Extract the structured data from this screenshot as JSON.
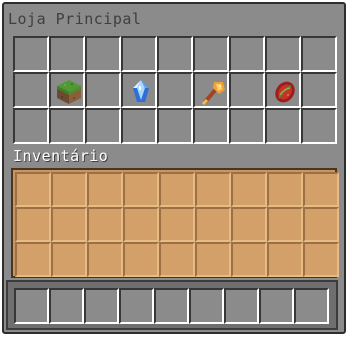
{
  "shop": {
    "title": "Loja Principal",
    "rows": 3,
    "columns": 9,
    "items": [
      {
        "row": 1,
        "col": 1,
        "icon": "grass-block-icon"
      },
      {
        "row": 1,
        "col": 3,
        "icon": "diamond-gem-icon"
      },
      {
        "row": 1,
        "col": 5,
        "icon": "golden-axe-icon"
      },
      {
        "row": 1,
        "col": 7,
        "icon": "red-seed-icon"
      }
    ]
  },
  "inventory": {
    "title": "Inventário",
    "rows": 3,
    "columns": 9
  },
  "hotbar": {
    "slots": 9
  },
  "colors": {
    "panel": "#8b8b8b",
    "inventory_bg": "#c99661",
    "title_text": "#3f3f3f"
  }
}
